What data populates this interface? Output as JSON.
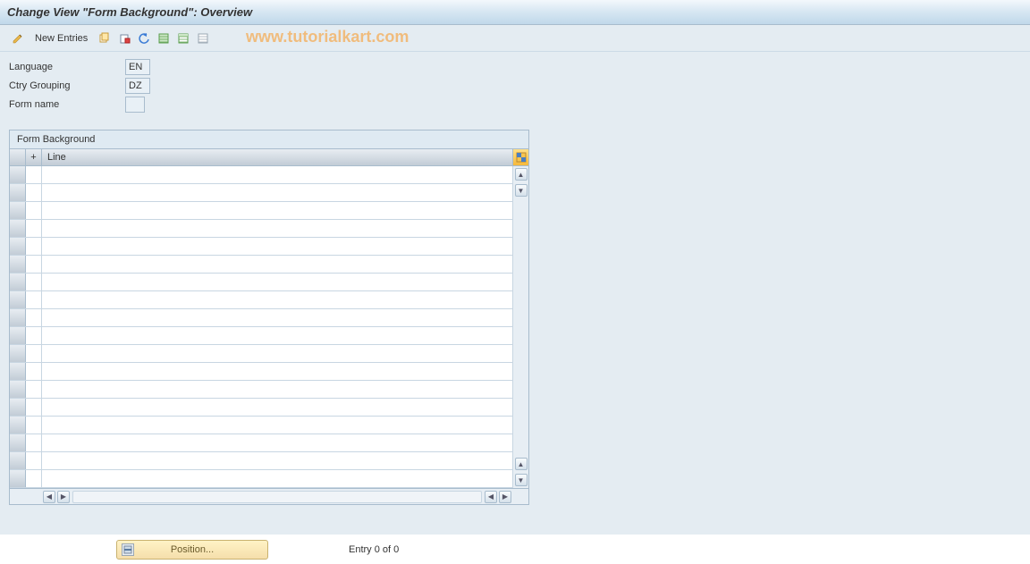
{
  "header": {
    "title": "Change View \"Form Background\": Overview"
  },
  "toolbar": {
    "new_entries_label": "New Entries"
  },
  "watermark": "www.tutorialkart.com",
  "form": {
    "language_label": "Language",
    "language_value": "EN",
    "ctry_grouping_label": "Ctry Grouping",
    "ctry_grouping_value": "DZ",
    "form_name_label": "Form name",
    "form_name_value": ""
  },
  "table": {
    "panel_title": "Form Background",
    "col_plus": "+",
    "col_line": "Line",
    "row_count": 18
  },
  "footer": {
    "position_label": "Position...",
    "entry_text": "Entry 0 of 0"
  }
}
